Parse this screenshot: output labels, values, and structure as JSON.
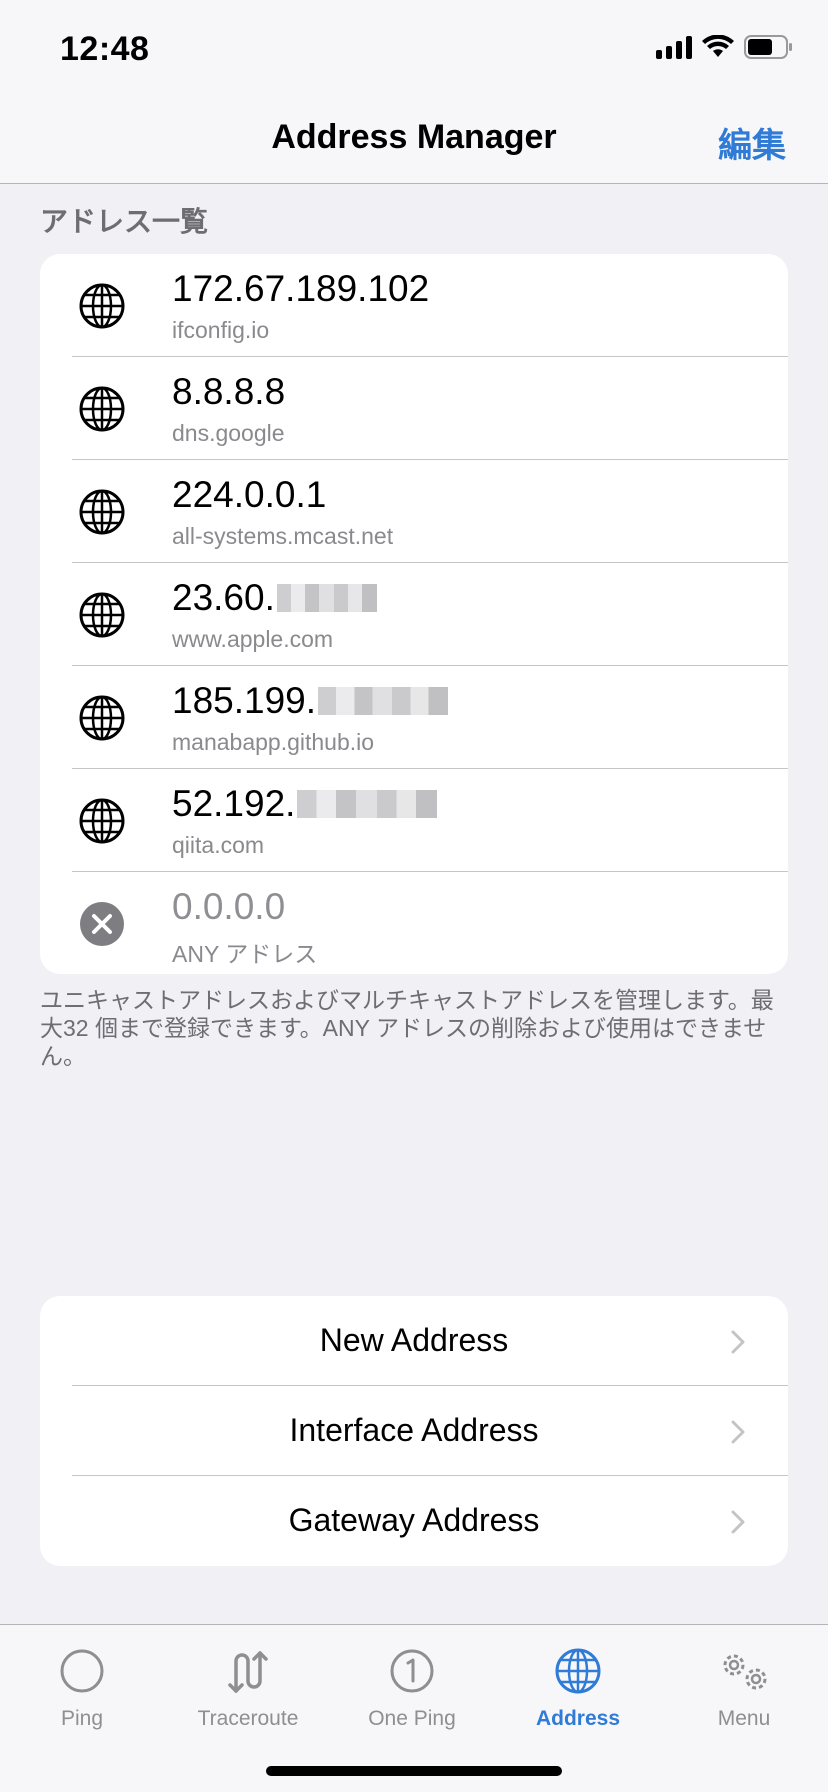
{
  "status": {
    "time": "12:48"
  },
  "nav": {
    "title": "Address Manager",
    "edit_label": "編集"
  },
  "section_header": "アドレス一覧",
  "addresses": [
    {
      "ip": "172.67.189.102",
      "host": "ifconfig.io",
      "icon": "globe-icon",
      "redacted": false
    },
    {
      "ip": "8.8.8.8",
      "host": "dns.google",
      "icon": "globe-icon",
      "redacted": false
    },
    {
      "ip": "224.0.0.1",
      "host": "all-systems.mcast.net",
      "icon": "globe-icon",
      "redacted": false
    },
    {
      "ip": "23.60.",
      "host": "www.apple.com",
      "icon": "globe-icon",
      "redacted": true
    },
    {
      "ip": "185.199.",
      "host": "manabapp.github.io",
      "icon": "globe-icon",
      "redacted": true
    },
    {
      "ip": "52.192.",
      "host": "qiita.com",
      "icon": "globe-icon",
      "redacted": true
    },
    {
      "ip": "0.0.0.0",
      "host": "ANY アドレス",
      "icon": "x-circle-icon",
      "redacted": false
    }
  ],
  "footer_note": "ユニキャストアドレスおよびマルチキャストアドレスを管理します。最大32 個まで登録できます。ANY アドレスの削除および使用はできません。",
  "actions": [
    {
      "label": "New Address"
    },
    {
      "label": "Interface Address"
    },
    {
      "label": "Gateway Address"
    }
  ],
  "tabs": [
    {
      "label": "Ping",
      "icon": "circle-icon",
      "active": false
    },
    {
      "label": "Traceroute",
      "icon": "traceroute-icon",
      "active": false
    },
    {
      "label": "One Ping",
      "icon": "one-circle-icon",
      "active": false
    },
    {
      "label": "Address",
      "icon": "globe-icon",
      "active": true
    },
    {
      "label": "Menu",
      "icon": "gears-icon",
      "active": false
    }
  ],
  "colors": {
    "accent": "#2f7bd6",
    "background": "#f0f0f5",
    "secondary_text": "#8a8a8e"
  }
}
